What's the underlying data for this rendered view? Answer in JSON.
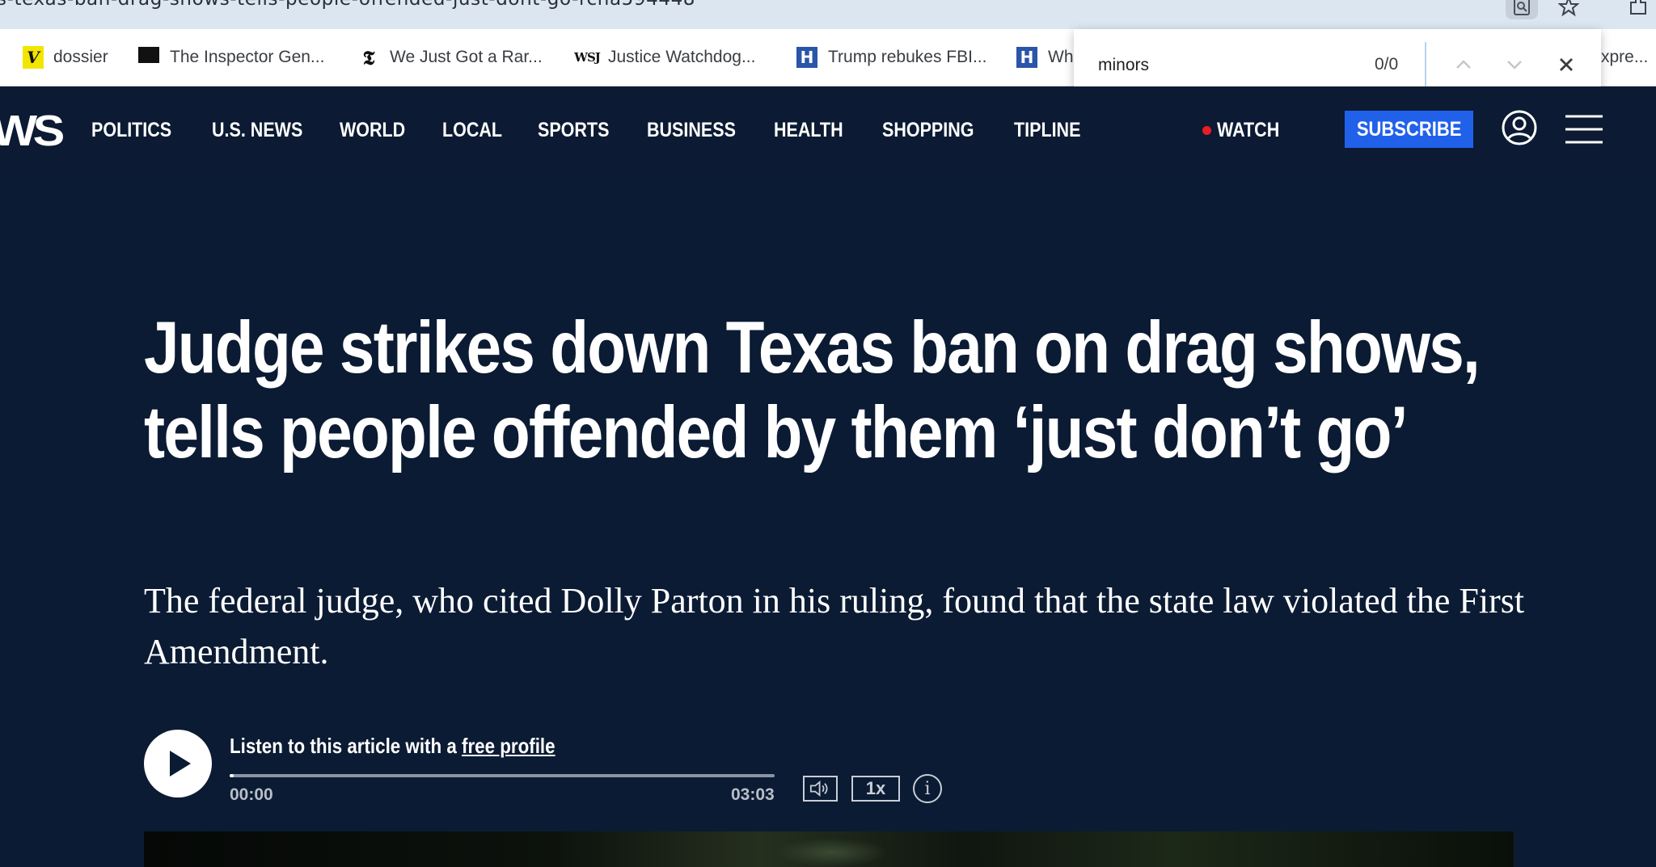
{
  "browser": {
    "url": "s-texas-ban-drag-shows-tells-people-offended-just-dont-go-rcna594448",
    "bookmarks": [
      {
        "label": "dossier",
        "icon": "V"
      },
      {
        "label": "The Inspector Gen...",
        "icon": "inspector-icon"
      },
      {
        "label": "We Just Got a Rar...",
        "icon": "𝕿"
      },
      {
        "label": "Justice Watchdog...",
        "icon": "WSJ"
      },
      {
        "label": "Trump rebukes FBI...",
        "icon": "H"
      },
      {
        "label": "Wh",
        "icon": "H"
      },
      {
        "label": "xpre..."
      }
    ],
    "find": {
      "query": "minors",
      "count": "0/0"
    }
  },
  "site": {
    "logo_partial": "WS",
    "nav": [
      "POLITICS",
      "U.S. NEWS",
      "WORLD",
      "LOCAL",
      "SPORTS",
      "BUSINESS",
      "HEALTH",
      "SHOPPING",
      "TIPLINE"
    ],
    "watch": "WATCH",
    "subscribe": "SUBSCRIBE",
    "colors": {
      "background": "#0b1b33",
      "subscribe": "#2161ea",
      "live_dot": "#e81d25"
    }
  },
  "article": {
    "headline": "Judge strikes down Texas ban on drag shows, tells people offended by them ‘just don’t go’",
    "dek": "The federal judge, who cited Dolly Parton in his ruling, found that the state law violated the First Amendment."
  },
  "audio": {
    "prompt": "Listen to this article with a",
    "link": "free profile",
    "current_time": "00:00",
    "total_time": "03:03",
    "progress_fraction": 0.008,
    "speed": "1x",
    "info": "i"
  }
}
